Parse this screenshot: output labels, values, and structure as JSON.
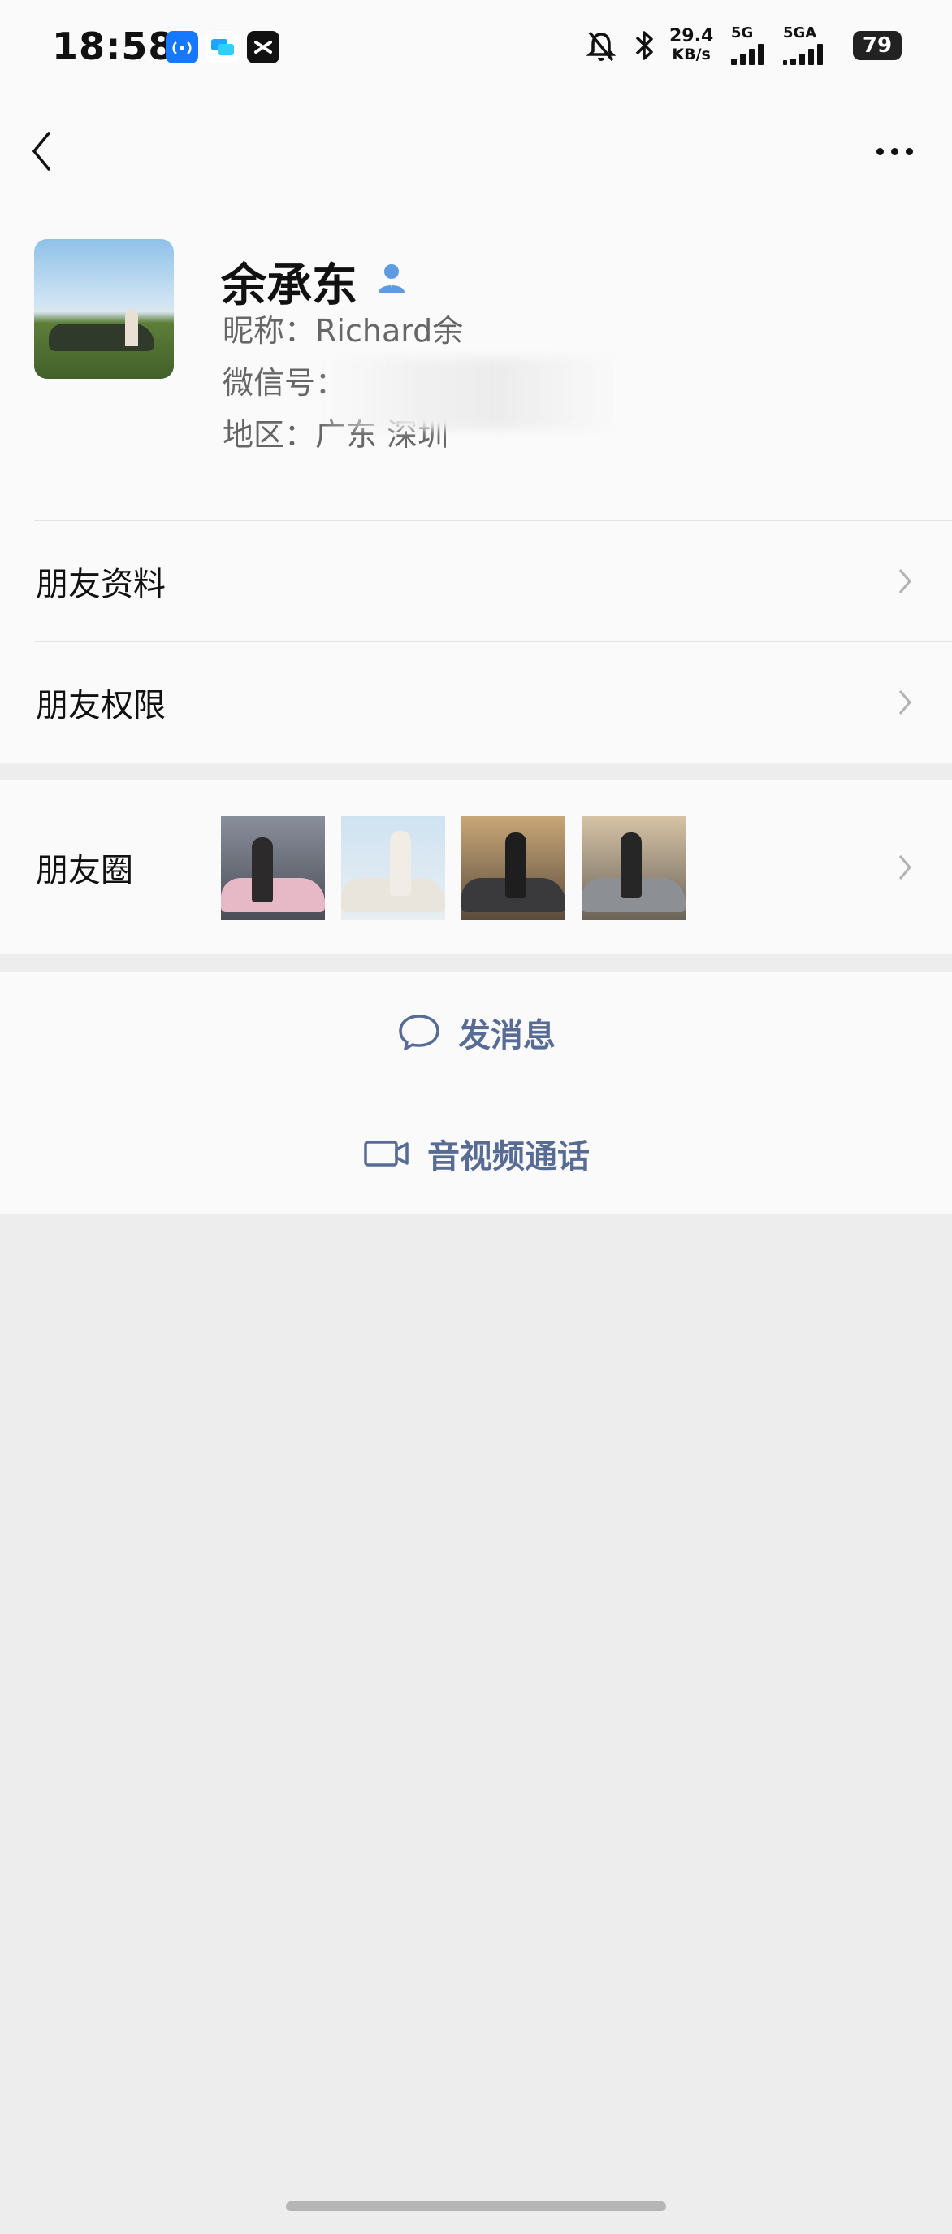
{
  "status_bar": {
    "time": "18:58",
    "net_speed_value": "29.4",
    "net_speed_unit": "KB/s",
    "signal1_label": "5G",
    "signal2_label": "5GA",
    "battery": "79"
  },
  "profile": {
    "name": "余承东",
    "nickname": "昵称：Richard余",
    "wechat_id_label": "微信号：",
    "region": "地区：广东 深圳"
  },
  "menu": {
    "friend_info": "朋友资料",
    "friend_permissions": "朋友权限",
    "moments": "朋友圈"
  },
  "actions": {
    "send_message": "发消息",
    "av_call": "音视频通话"
  },
  "colors": {
    "accent": "#576b95",
    "background": "#ededed",
    "card": "#fafafa"
  }
}
